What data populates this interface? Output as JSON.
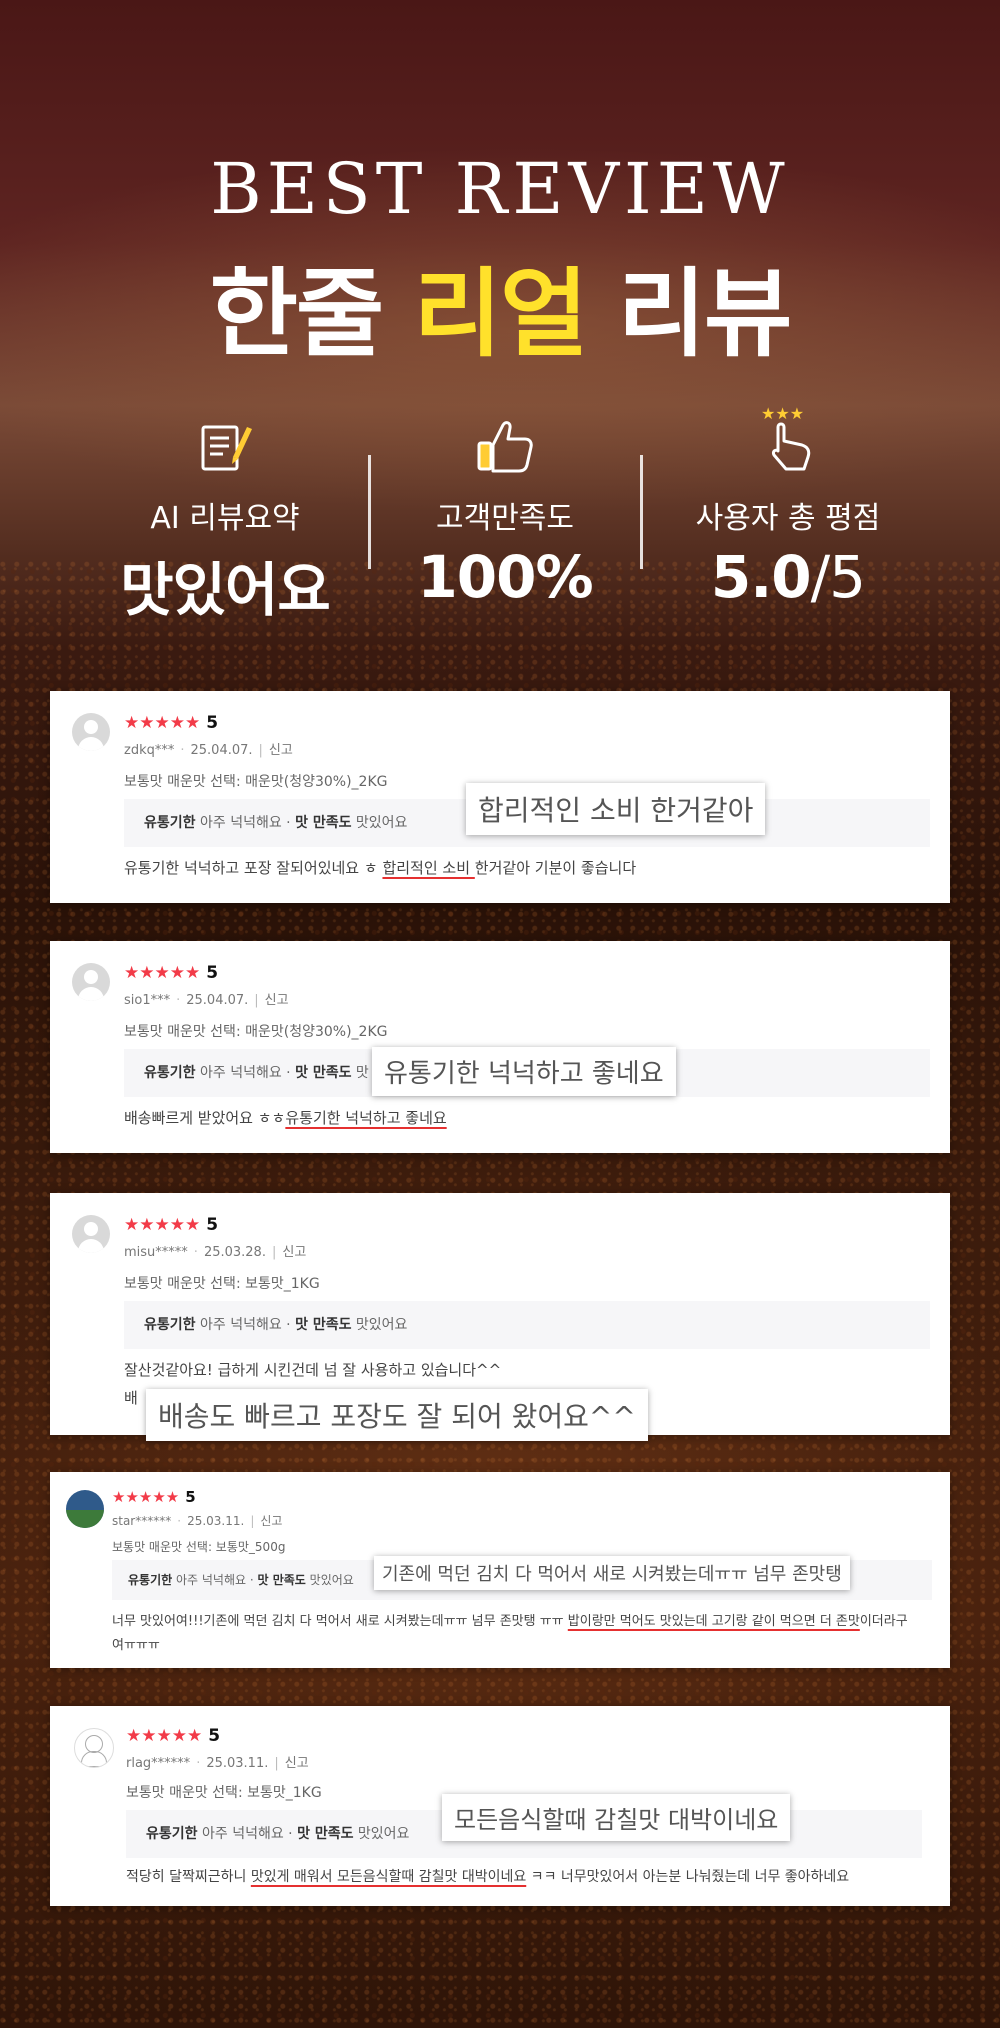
{
  "header": {
    "eyebrow": "BEST REVIEW",
    "title_part1": "한줄 ",
    "title_highlight": "리얼",
    "title_part3": " 리뷰",
    "highlight_color": "#ffe12b"
  },
  "stats": [
    {
      "icon": "document-pen-icon",
      "label": "AI 리뷰요약",
      "value": "맛있어요",
      "suffix": ""
    },
    {
      "icon": "thumbs-up-icon",
      "label": "고객만족도",
      "value": "100%",
      "suffix": ""
    },
    {
      "icon": "click-stars-icon",
      "label": "사용자 총 평점",
      "value": "5.0",
      "suffix": "/5"
    }
  ],
  "reviews": [
    {
      "stars": "★★★★★",
      "rating": "5",
      "user": "zdkq***",
      "date": "25.04.07.",
      "report": "신고",
      "option": "보통맛 매운맛 선택: 매운맛(청양30%)_2KG",
      "tag1_key": "유통기한",
      "tag1_val": " 아주 넉넉해요 · ",
      "tag2_key": "맛 만족도",
      "tag2_val": " 맛있어요",
      "text_pre": "유통기한 넉넉하고 포장 잘되어있네요 ㅎ ",
      "text_hl": "합리적인 소비 ",
      "text_post": "한거같아 기분이 좋습니다",
      "callout": "합리적인 소비 한거같아"
    },
    {
      "stars": "★★★★★",
      "rating": "5",
      "user": "sio1***",
      "date": "25.04.07.",
      "report": "신고",
      "option": "보통맛 매운맛 선택: 매운맛(청양30%)_2KG",
      "tag1_key": "유통기한",
      "tag1_val": " 아주 넉넉해요 · ",
      "tag2_key": "맛 만족도",
      "tag2_val": " 맛",
      "text_pre": "배송빠르게 받았어요 ㅎㅎ",
      "text_hl": "유통기한 넉넉하고 좋네요",
      "text_post": "",
      "callout": "유통기한 넉넉하고 좋네요"
    },
    {
      "stars": "★★★★★",
      "rating": "5",
      "user": "misu*****",
      "date": "25.03.28.",
      "report": "신고",
      "option": "보통맛 매운맛 선택: 보통맛_1KG",
      "tag1_key": "유통기한",
      "tag1_val": " 아주 넉넉해요 · ",
      "tag2_key": "맛 만족도",
      "tag2_val": " 맛있어요",
      "text_pre": "잘산것같아요! 급하게 시킨건데 넘 잘 사용하고 있습니다^^",
      "text_hl": "",
      "text_post": "",
      "text2": "배",
      "callout": "배송도 빠르고 포장도 잘 되어 왔어요^^"
    },
    {
      "stars": "★★★★★",
      "rating": "5",
      "user": "star******",
      "date": "25.03.11.",
      "report": "신고",
      "option": "보통맛 매운맛 선택: 보통맛_500g",
      "tag1_key": "유통기한",
      "tag1_val": " 아주 넉넉해요 · ",
      "tag2_key": "맛 만족도",
      "tag2_val": " 맛있어요",
      "text_pre": "너무 맛있어여!!!기존에 먹던 김치 다 먹어서 새로 시켜봤는데ㅠㅠ 넘무 존맛탱 ㅠㅠ ",
      "text_hl": "밥이랑만 먹어도 맛있는데 고기랑 같이 먹으면 더 존맛",
      "text_post": "이더라구",
      "text2": "여ㅠㅠㅠ",
      "callout": "기존에 먹던 김치 다 먹어서 새로 시켜봤는데ㅠㅠ 넘무 존맛탱"
    },
    {
      "stars": "★★★★★",
      "rating": "5",
      "user": "rlag******",
      "date": "25.03.11.",
      "report": "신고",
      "option": "보통맛 매운맛 선택: 보통맛_1KG",
      "tag1_key": "유통기한",
      "tag1_val": " 아주 넉넉해요 · ",
      "tag2_key": "맛 만족도",
      "tag2_val": " 맛있어요",
      "text_pre": "적당히 달짝찌근하니 ",
      "text_hl": "맛있게 매워서 모든음식할때 감칠맛 대박이네요",
      "text_post": " ㅋㅋ 너무맛있어서 아는분 나눠줬는데 너무 좋아하네요",
      "callout": "모든음식할때 감칠맛 대박이네요"
    }
  ]
}
